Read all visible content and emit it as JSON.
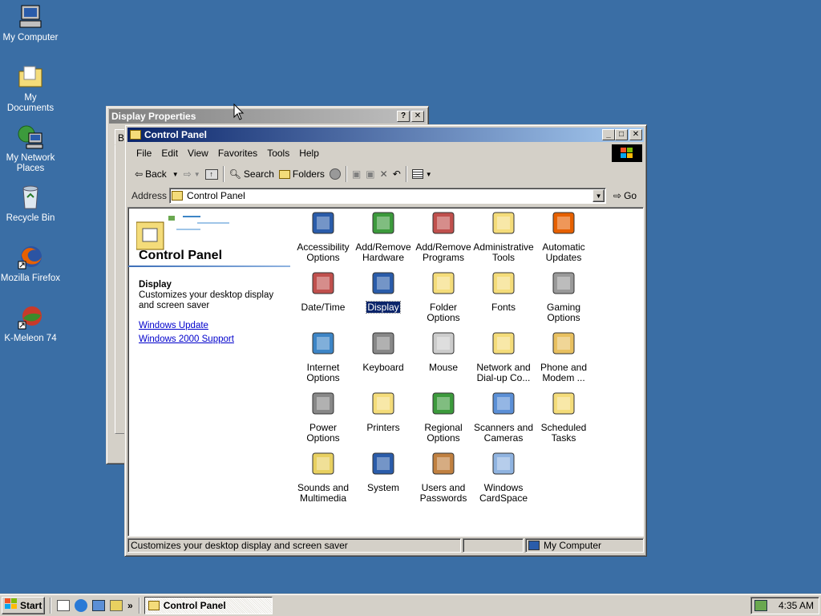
{
  "desktop": {
    "icons": [
      {
        "label": "My Computer",
        "icon": "computer-icon"
      },
      {
        "label": "My Documents",
        "icon": "folder-documents-icon"
      },
      {
        "label": "My Network Places",
        "icon": "network-icon"
      },
      {
        "label": "Recycle Bin",
        "icon": "recycle-bin-icon"
      },
      {
        "label": "Mozilla Firefox",
        "icon": "firefox-icon"
      },
      {
        "label": "K-Meleon 74",
        "icon": "kmeleon-icon"
      }
    ]
  },
  "display_properties": {
    "title": "Display Properties",
    "help_btn": "?",
    "close_btn": "✕",
    "tab_peek": "B"
  },
  "control_panel": {
    "title": "Control Panel",
    "buttons": {
      "minimize": "_",
      "maximize": "□",
      "close": "✕"
    },
    "menu": [
      "File",
      "Edit",
      "View",
      "Favorites",
      "Tools",
      "Help"
    ],
    "toolbar": {
      "back": "Back",
      "search": "Search",
      "folders": "Folders"
    },
    "address": {
      "label": "Address",
      "value": "Control Panel",
      "go": "Go"
    },
    "side": {
      "heading": "Control Panel",
      "selected_title": "Display",
      "selected_desc": "Customizes your desktop display and screen saver",
      "links": [
        "Windows Update",
        "Windows 2000 Support"
      ]
    },
    "items": [
      {
        "label": "Accessibility Options",
        "icon": "accessibility-icon"
      },
      {
        "label": "Add/Remove Hardware",
        "icon": "hardware-icon"
      },
      {
        "label": "Add/Remove Programs",
        "icon": "programs-icon"
      },
      {
        "label": "Administrative Tools",
        "icon": "admin-tools-icon"
      },
      {
        "label": "Automatic Updates",
        "icon": "windows-update-icon"
      },
      {
        "label": "Date/Time",
        "icon": "clock-icon"
      },
      {
        "label": "Display",
        "icon": "monitor-icon"
      },
      {
        "label": "Folder Options",
        "icon": "folder-options-icon"
      },
      {
        "label": "Fonts",
        "icon": "fonts-folder-icon"
      },
      {
        "label": "Gaming Options",
        "icon": "joystick-icon"
      },
      {
        "label": "Internet Options",
        "icon": "globe-icon"
      },
      {
        "label": "Keyboard",
        "icon": "keyboard-icon"
      },
      {
        "label": "Mouse",
        "icon": "mouse-icon"
      },
      {
        "label": "Network and Dial-up Co...",
        "icon": "network-folder-icon"
      },
      {
        "label": "Phone and Modem ...",
        "icon": "phone-icon"
      },
      {
        "label": "Power Options",
        "icon": "power-icon"
      },
      {
        "label": "Printers",
        "icon": "printer-folder-icon"
      },
      {
        "label": "Regional Options",
        "icon": "regional-globe-icon"
      },
      {
        "label": "Scanners and Cameras",
        "icon": "scanner-icon"
      },
      {
        "label": "Scheduled Tasks",
        "icon": "scheduled-tasks-icon"
      },
      {
        "label": "Sounds and Multimedia",
        "icon": "speaker-icon"
      },
      {
        "label": "System",
        "icon": "system-computer-icon"
      },
      {
        "label": "Users and Passwords",
        "icon": "users-icon"
      },
      {
        "label": "Windows CardSpace",
        "icon": "cardspace-icon"
      }
    ],
    "selected_index": 6,
    "status": {
      "text": "Customizes your desktop display and screen saver",
      "zone": "My Computer"
    }
  },
  "taskbar": {
    "start": "Start",
    "quicklaunch_more": "»",
    "task": "Control Panel",
    "clock": "4:35 AM"
  },
  "colors": {
    "desktop": "#3a6ea5",
    "title_active": "#0a246a",
    "selection": "#0a246a"
  }
}
